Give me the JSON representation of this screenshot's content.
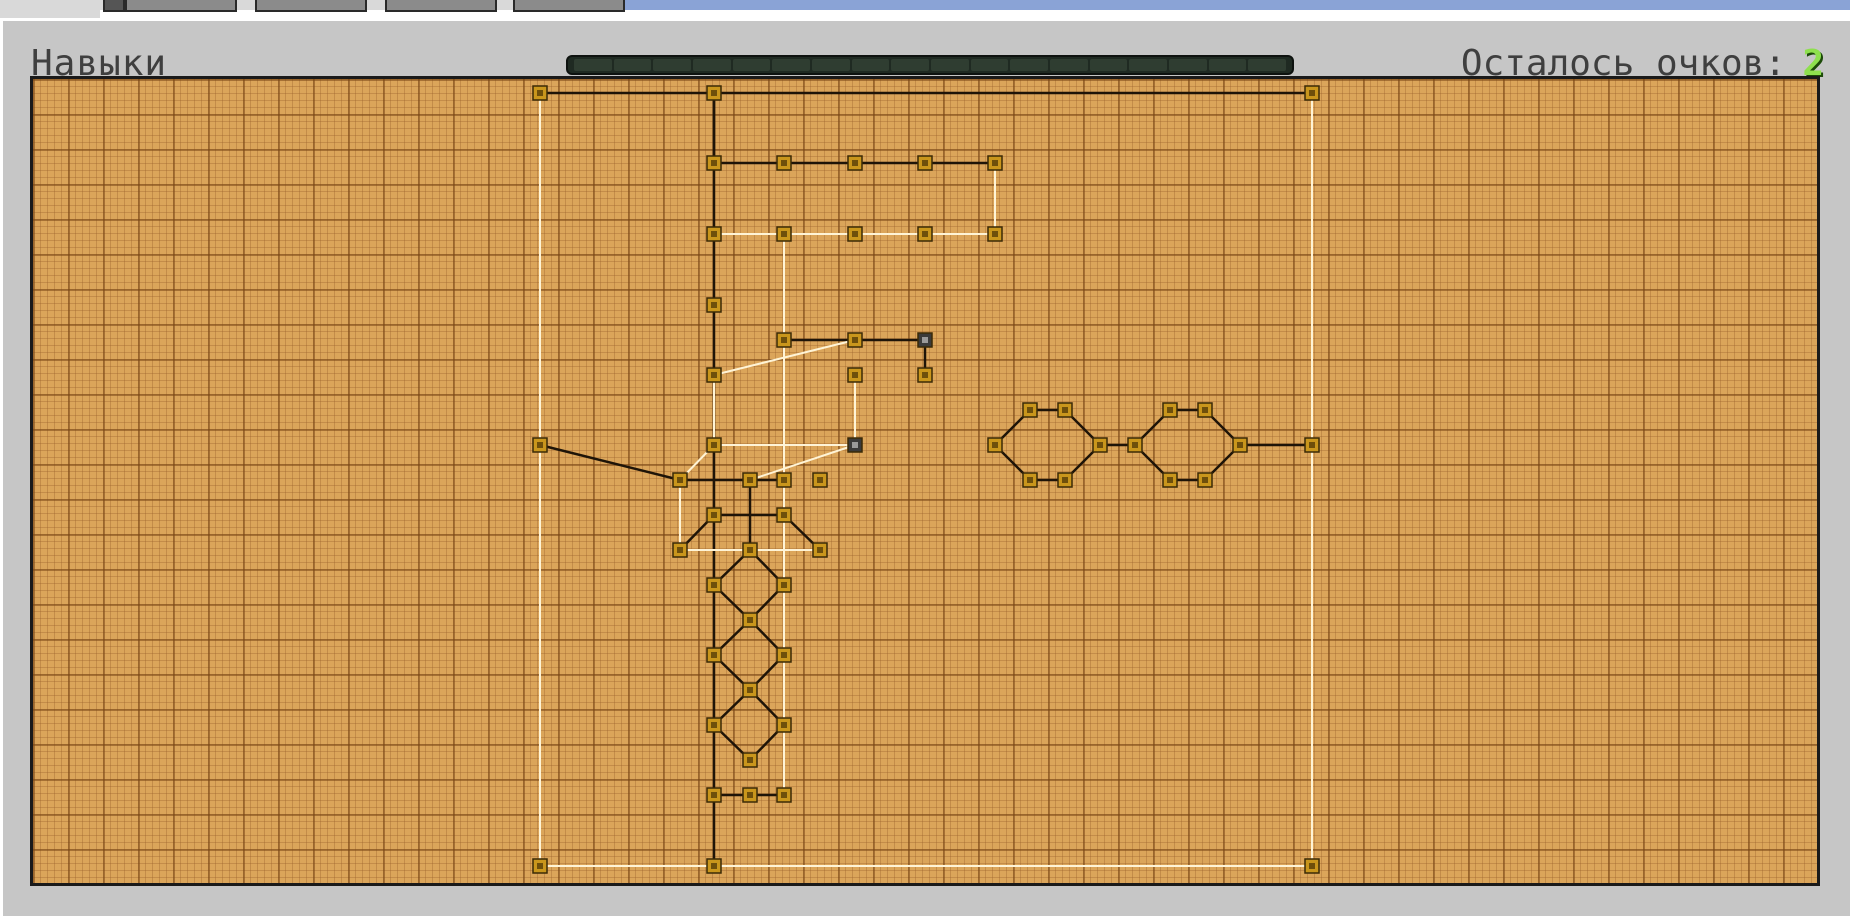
{
  "window": {
    "title": "Навыки",
    "points_label": "Осталось очков:",
    "points_value": "2"
  },
  "colors": {
    "board": "#dba55a",
    "node": "#c9961c",
    "node_locked": "#3a3a3a",
    "link_dark": "#1e1408",
    "link_light": "#fff4d6",
    "points": "#8ee04e"
  },
  "icons": {
    "node": "skill-node-icon",
    "locked_node": "locked-skill-node-icon",
    "cross_node": "selected-skill-node-icon"
  }
}
